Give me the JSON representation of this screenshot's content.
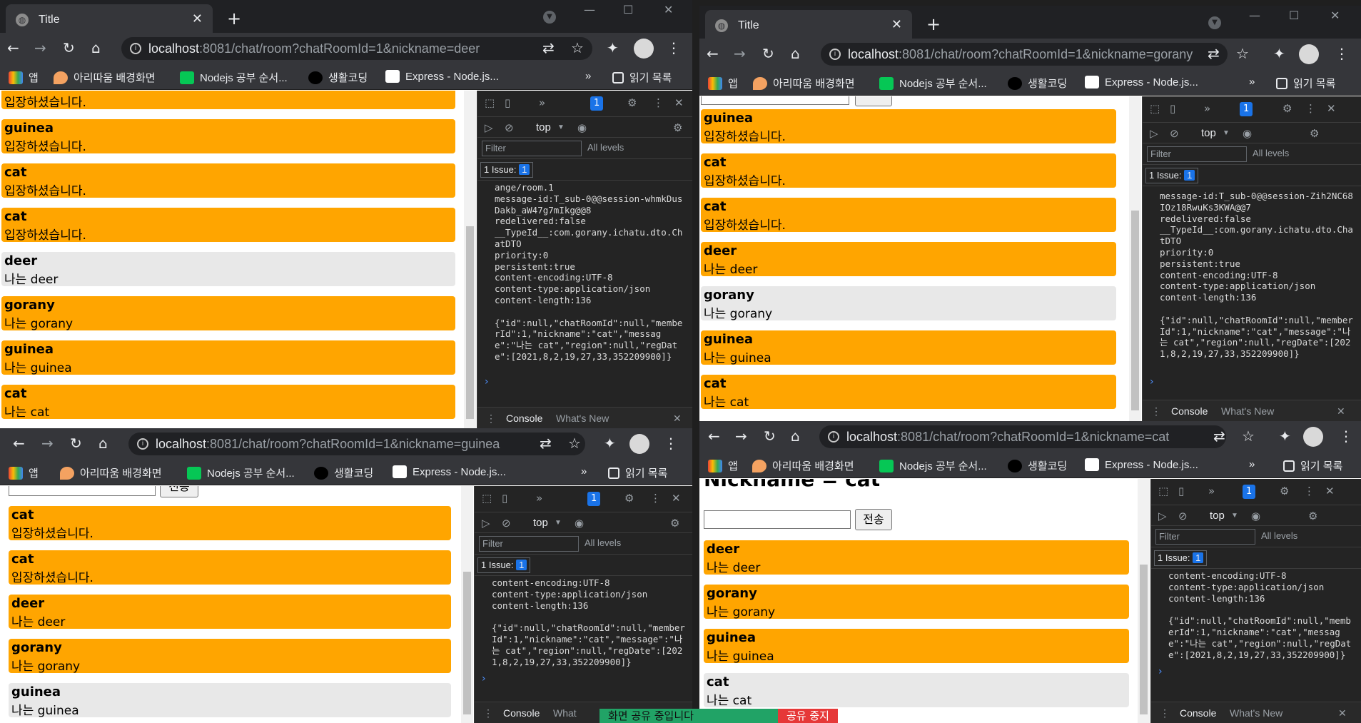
{
  "tab_title": "Title",
  "bookmarks": {
    "apps": "앱",
    "b1": "아리따움 배경화면",
    "b2": "Nodejs 공부 순서...",
    "b3": "생활코딩",
    "b4": "Express - Node.js...",
    "reading": "읽기 목록"
  },
  "icons": {
    "apps": "apps-grid-icon",
    "marker": "map-marker-icon",
    "line": "line-app-icon",
    "circle": "opentutorials-icon",
    "express": "express-icon",
    "reading": "reading-list-icon"
  },
  "url": {
    "host": "localhost",
    "port_deer": ":8081/chat/room?chatRoomId=1&nickname=deer",
    "port_gorany": ":8081/chat/room?chatRoomId=1&nickname=gorany",
    "port_guinea": ":8081/chat/room?chatRoomId=1&nickname=guinea",
    "port_cat": ":8081/chat/room?chatRoomId=1&nickname=cat"
  },
  "msgs": {
    "enter": "입장하셨습니다.",
    "i_deer": "나는 deer",
    "i_gorany": "나는 gorany",
    "i_guinea": "나는 guinea",
    "i_cat": "나는 cat",
    "deer": "deer",
    "gorany": "gorany",
    "guinea": "guinea",
    "cat": "cat"
  },
  "devtools": {
    "top": "top",
    "filter": "Filter",
    "levels": "All levels",
    "issue": "1 Issue:",
    "badge": "1",
    "console": "Console",
    "whatsnew": "What's New",
    "whatsnew_short": "What"
  },
  "logs": {
    "deer": "ange/room.1\nmessage-id:T_sub-0@@session-whmkDusDakb_aW47g7mIkg@@8\nredelivered:false\n__TypeId__:com.gorany.ichatu.dto.ChatDTO\npriority:0\npersistent:true\ncontent-encoding:UTF-8\ncontent-type:application/json\ncontent-length:136\n\n{\"id\":null,\"chatRoomId\":null,\"memberId\":1,\"nickname\":\"cat\",\"message\":\"나는 cat\",\"region\":null,\"regDate\":[2021,8,2,19,27,33,352209900]}",
    "gorany": "message-id:T_sub-0@@session-Zih2NC68IOz18RwuKs3KWA@@7\nredelivered:false\n__TypeId__:com.gorany.ichatu.dto.ChatDTO\npriority:0\npersistent:true\ncontent-encoding:UTF-8\ncontent-type:application/json\ncontent-length:136\n\n{\"id\":null,\"chatRoomId\":null,\"memberId\":1,\"nickname\":\"cat\",\"message\":\"나는 cat\",\"region\":null,\"regDate\":[2021,8,2,19,27,33,352209900]}",
    "guinea": "content-encoding:UTF-8\ncontent-type:application/json\ncontent-length:136\n\n{\"id\":null,\"chatRoomId\":null,\"memberId\":1,\"nickname\":\"cat\",\"message\":\"나는 cat\",\"region\":null,\"regDate\":[2021,8,2,19,27,33,352209900]}",
    "cat": "content-encoding:UTF-8\ncontent-type:application/json\ncontent-length:136\n\n{\"id\":null,\"chatRoomId\":null,\"memberId\":1,\"nickname\":\"cat\",\"message\":\"나는 cat\",\"region\":null,\"regDate\":[2021,8,2,19,27,33,352209900]}"
  },
  "page": {
    "heading": "Nickname = cat",
    "send": "전송"
  },
  "share": {
    "sharing": "화면 공유 중입니다",
    "stop": "공유 중지"
  },
  "colors": {
    "mine": "#e8e8e8",
    "other": "#ffa500"
  }
}
